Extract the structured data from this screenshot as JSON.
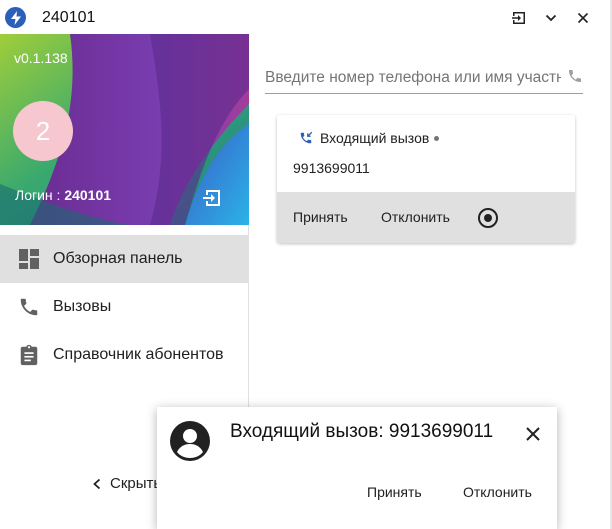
{
  "window": {
    "title": "240101",
    "accent": "#2b5fb8"
  },
  "sidebar": {
    "version": "v0.1.138",
    "avatar_letter": "2",
    "avatar_color": "#f6c7cf",
    "login_label": "Логин : ",
    "login_value": "240101",
    "items": [
      {
        "label": "Обзорная панель",
        "icon": "dashboard-icon",
        "active": true
      },
      {
        "label": "Вызовы",
        "icon": "phone-icon",
        "active": false
      },
      {
        "label": "Справочник абонентов",
        "icon": "clipboard-icon",
        "active": false
      }
    ],
    "collapse_label": "Скрыть"
  },
  "search": {
    "placeholder": "Введите номер телефона или имя участника",
    "value": ""
  },
  "call_card": {
    "status": "Входящий вызов",
    "number": "9913699011",
    "accept_label": "Принять",
    "decline_label": "Отклонить"
  },
  "toast": {
    "title": "Входящий вызов: 9913699011",
    "accept_label": "Принять",
    "decline_label": "Отклонить"
  }
}
